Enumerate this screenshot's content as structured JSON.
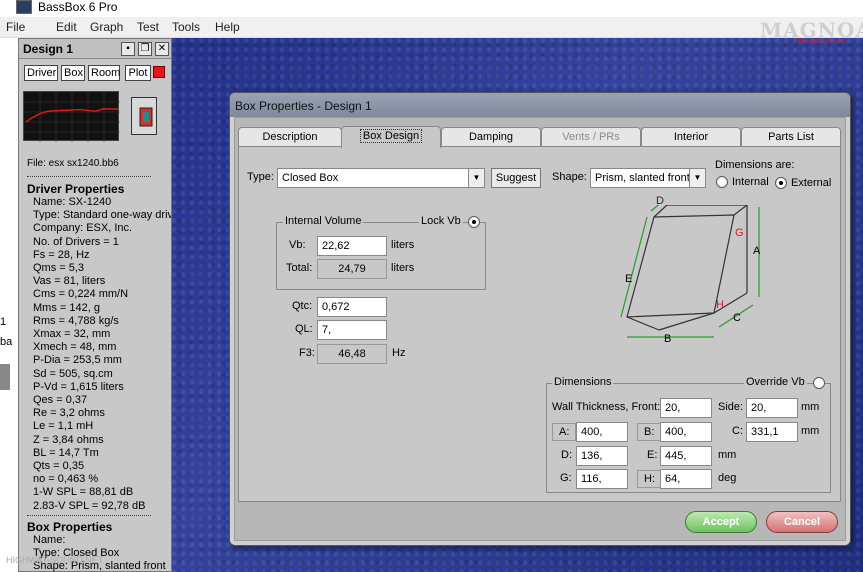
{
  "app": {
    "title": "BassBox 6 Pro"
  },
  "menu": [
    "File",
    "Edit",
    "Graph",
    "Test",
    "Tools",
    "Help"
  ],
  "logo": {
    "text": "MAGNOA",
    "sub": "Everlasting Music"
  },
  "left_strip": {
    "item1": "1",
    "item2": "ba"
  },
  "design_panel": {
    "title": "Design 1",
    "tabs": [
      "Driver",
      "Box",
      "Room",
      "Plot"
    ],
    "plot_color": "#e8141a",
    "file": "File: esx sx1240.bb6",
    "driver_title": "Driver Properties",
    "driver_props": [
      "Name: SX-1240",
      "Type: Standard one-way driver",
      "Company: ESX, Inc.",
      "No. of Drivers = 1",
      "Fs = 28, Hz",
      "Qms = 5,3",
      "Vas = 81, liters",
      "Cms = 0,224 mm/N",
      "Mms = 142, g",
      "Rms = 4,788 kg/s",
      "Xmax = 32, mm",
      "Xmech = 48, mm",
      "P-Dia = 253,5 mm",
      "Sd = 505, sq.cm",
      "P-Vd = 1,615 liters",
      "Qes = 0,37",
      "Re = 3,2 ohms",
      "Le = 1,1 mH",
      "Z = 3,84 ohms",
      "BL = 14,7 Tm",
      "Qts = 0,35",
      "no = 0,463 %",
      "1-W SPL = 88,81 dB",
      "2.83-V SPL = 92,78 dB"
    ],
    "box_title": "Box Properties",
    "box_props": [
      "Name:",
      "Type: Closed Box",
      "Shape: Prism, slanted front"
    ]
  },
  "dialog": {
    "title": "Box Properties - Design 1",
    "tabs": [
      {
        "label": "Description",
        "state": "normal"
      },
      {
        "label": "Box Design",
        "state": "active"
      },
      {
        "label": "Damping",
        "state": "normal"
      },
      {
        "label": "Vents / PRs",
        "state": "disabled"
      },
      {
        "label": "Interior",
        "state": "normal"
      },
      {
        "label": "Parts List",
        "state": "normal"
      }
    ],
    "type_label": "Type:",
    "type_value": "Closed Box",
    "suggest": "Suggest",
    "shape_label": "Shape:",
    "shape_value": "Prism, slanted front",
    "dims_are": "Dimensions are:",
    "internal": "Internal",
    "external": "External",
    "dims_mode": "external",
    "internal_volume": {
      "title": "Internal Volume",
      "lock": "Lock Vb",
      "vb_label": "Vb:",
      "vb": "22,62",
      "vb_unit": "liters",
      "total_label": "Total:",
      "total": "24,79",
      "total_unit": "liters"
    },
    "qtc_label": "Qtc:",
    "qtc": "0,672",
    "ql_label": "QL:",
    "ql": "7,",
    "f3_label": "F3:",
    "f3": "46,48",
    "f3_unit": "Hz",
    "diagram_labels": {
      "A": "A",
      "B": "B",
      "C": "C",
      "D": "D",
      "E": "E",
      "G": "G",
      "H": "H"
    },
    "dimensions": {
      "title": "Dimensions",
      "override": "Override Vb",
      "wall_label": "Wall Thickness, Front:",
      "front": "20,",
      "side_label": "Side:",
      "side": "20,",
      "mm": "mm",
      "a_label": "A:",
      "a": "400,",
      "b_label": "B:",
      "b": "400,",
      "c_label": "C:",
      "c": "331,1",
      "d_label": "D:",
      "d": "136,",
      "e_label": "E:",
      "e": "445,",
      "g_label": "G:",
      "g": "116,",
      "h_label": "H:",
      "h": "64,",
      "deg": "deg"
    },
    "accept": "Accept",
    "cancel": "Cancel"
  },
  "watermark": "HIGHWAY-SOUND.NET"
}
